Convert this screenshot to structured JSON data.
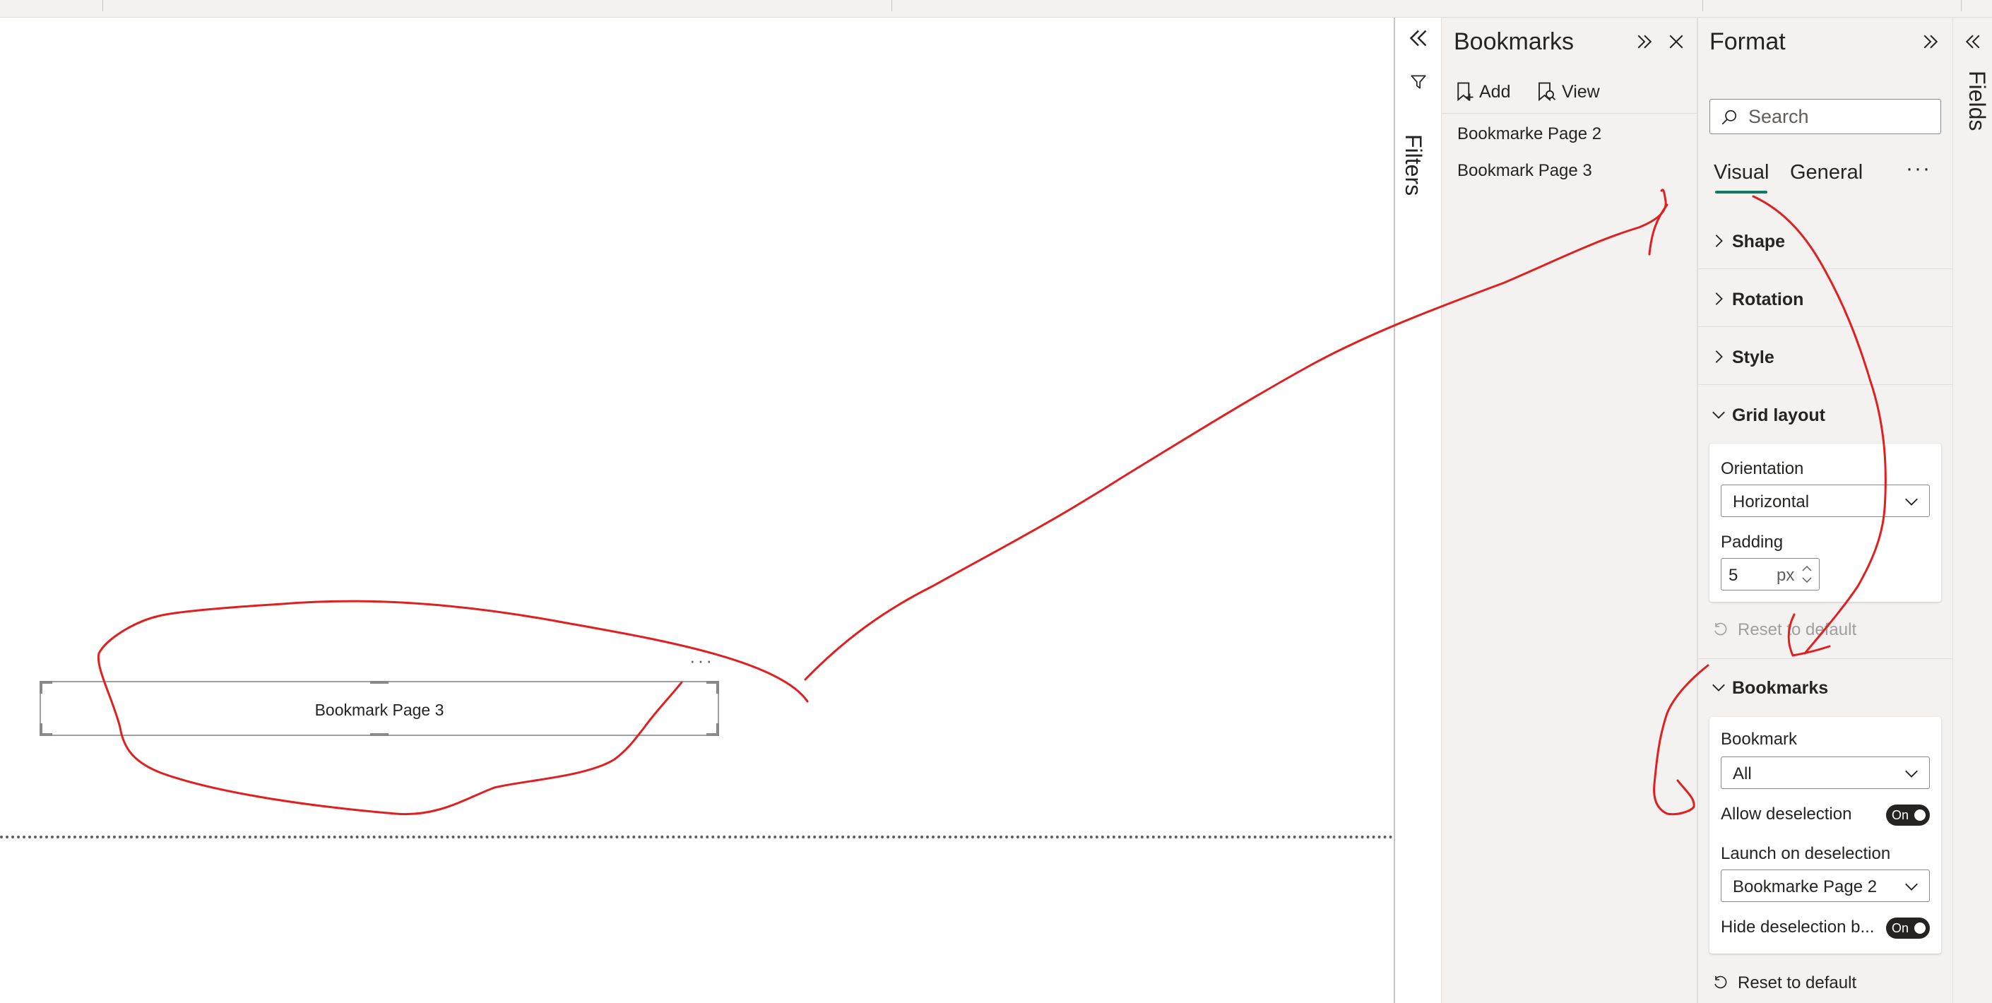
{
  "canvas": {
    "visual": {
      "label": "Bookmark Page 3",
      "more_glyph": "···"
    }
  },
  "filters_pane": {
    "label": "Filters"
  },
  "bookmarks_pane": {
    "title": "Bookmarks",
    "add_label": "Add",
    "view_label": "View",
    "items": [
      {
        "label": "Bookmarke Page 2"
      },
      {
        "label": "Bookmark Page 3"
      }
    ]
  },
  "format_pane": {
    "title": "Format",
    "search": {
      "placeholder": "Search"
    },
    "tabs": [
      {
        "label": "Visual",
        "selected": true
      },
      {
        "label": "General",
        "selected": false
      }
    ],
    "tabs_more": "···",
    "sections": {
      "shape": "Shape",
      "rotation": "Rotation",
      "style": "Style",
      "grid_layout": {
        "label": "Grid layout",
        "orientation_label": "Orientation",
        "orientation_value": "Horizontal",
        "padding_label": "Padding",
        "padding_value": "5",
        "padding_unit": "px",
        "reset_label": "Reset to default"
      },
      "bookmarks": {
        "label": "Bookmarks",
        "bookmark_label": "Bookmark",
        "bookmark_value": "All",
        "allow_deselection_label": "Allow deselection",
        "allow_deselection_toggle": "On",
        "launch_label": "Launch on deselection",
        "launch_value": "Bookmarke Page 2",
        "hide_label": "Hide deselection b...",
        "hide_toggle": "On",
        "reset_label": "Reset to default"
      }
    }
  },
  "fields_pane": {
    "label": "Fields"
  },
  "colors": {
    "accent_underline": "#117865",
    "annotation_red": "#e02020",
    "pane_bg": "#f3f2f1",
    "toggle_on": "#252423"
  }
}
